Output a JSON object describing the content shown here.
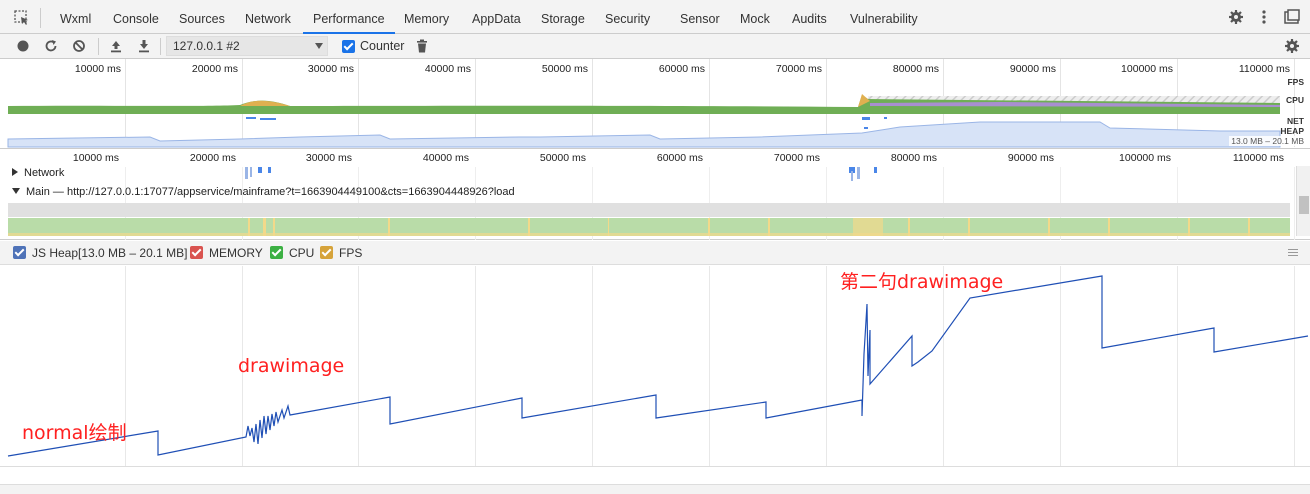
{
  "tabs": {
    "items": [
      "Wxml",
      "Console",
      "Sources",
      "Network",
      "Performance",
      "Memory",
      "AppData",
      "Storage",
      "Security",
      "Sensor",
      "Mock",
      "Audits",
      "Vulnerability"
    ],
    "active": "Performance"
  },
  "toolbar": {
    "target": "127.0.0.1 #2",
    "counter_label": "Counter"
  },
  "overview": {
    "time_labels": [
      "10000 ms",
      "20000 ms",
      "30000 ms",
      "40000 ms",
      "50000 ms",
      "60000 ms",
      "70000 ms",
      "80000 ms",
      "90000 ms",
      "100000 ms",
      "110000 ms"
    ],
    "fps_label": "FPS",
    "cpu_label": "CPU",
    "net_label": "NET",
    "heap_label": "HEAP",
    "heap_range": "13.0 MB – 20.1 MB"
  },
  "flamechart": {
    "time_labels": [
      "10000 ms",
      "20000 ms",
      "30000 ms",
      "40000 ms",
      "50000 ms",
      "60000 ms",
      "70000 ms",
      "80000 ms",
      "90000 ms",
      "100000 ms",
      "110000 ms"
    ],
    "network_track": "Network",
    "main_track": "Main — http://127.0.0.1:17077/appservice/mainframe?t=1663904449100&cts=1663904448926?load"
  },
  "legend": {
    "js_heap": "JS Heap[13.0 MB – 20.1 MB]",
    "memory": "MEMORY",
    "cpu": "CPU",
    "fps": "FPS"
  },
  "annotations": {
    "normal": "normal绘制",
    "drawimage": "drawimage",
    "second": "第二句drawimage"
  },
  "colors": {
    "accent": "#1a73e8",
    "heap_line": "#1f4fb5",
    "annotation": "#ff2020",
    "memory_check": "#d9534f",
    "cpu_check": "#3cb043",
    "fps_check": "#d6a33a"
  },
  "icons": [
    "inspect-icon",
    "record-icon",
    "reload-icon",
    "clear-icon",
    "upload-icon",
    "download-icon",
    "trash-icon",
    "gear-icon",
    "kebab-icon",
    "dock-icon"
  ]
}
